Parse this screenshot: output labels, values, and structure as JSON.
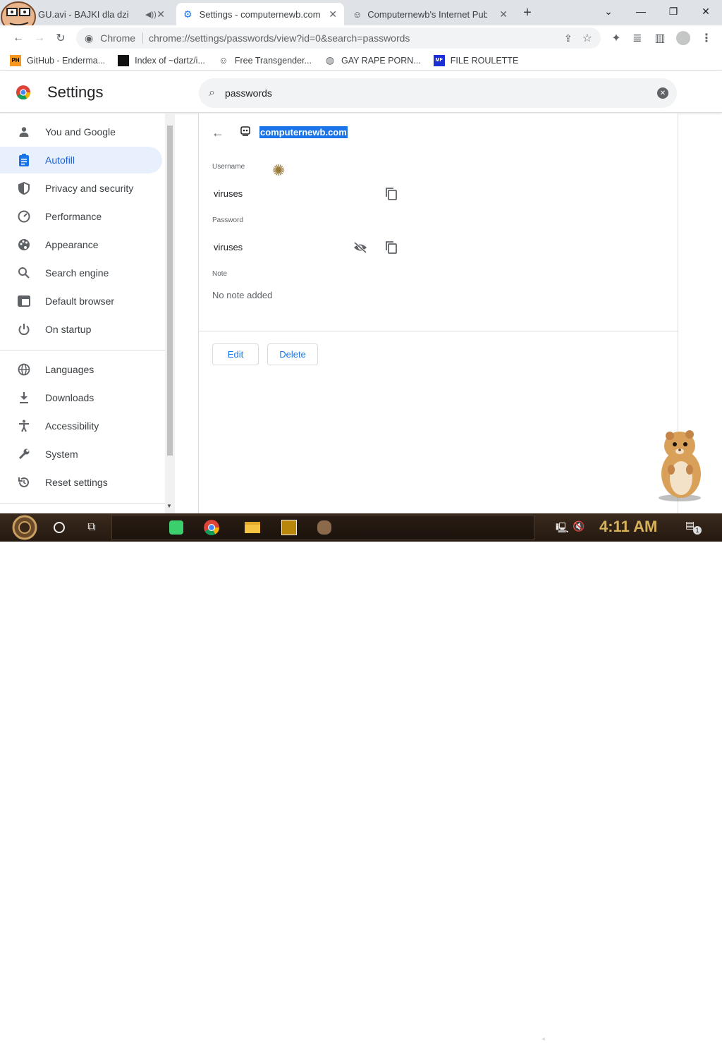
{
  "colors": {
    "accent": "#1a73e8",
    "active_nav_bg": "#e8f0fe",
    "highlight": "#1a73e8",
    "clock": "#d8b25a"
  },
  "tabs": [
    {
      "title": "GU.avi - BAJKI dla dzi",
      "audio_icon": "speaker-icon",
      "active": false
    },
    {
      "title": "Settings - computernewb.com",
      "active": true
    },
    {
      "title": "Computernewb's Internet Pub",
      "active": false
    }
  ],
  "omnibox": {
    "chip": "Chrome",
    "url": "chrome://settings/passwords/view?id=0&search=passwords"
  },
  "bookmarks": [
    {
      "label": "GitHub - Enderma...",
      "icon": "PH"
    },
    {
      "label": "Index of ~dartz/i...",
      "icon": "grid"
    },
    {
      "label": "Free Transgender...",
      "icon": "face"
    },
    {
      "label": "GAY RAPE PORN...",
      "icon": "globe"
    },
    {
      "label": "FILE ROULETTE",
      "icon": "MF"
    }
  ],
  "settings": {
    "title": "Settings",
    "search_value": "passwords"
  },
  "sidebar": {
    "items": [
      {
        "label": "You and Google",
        "icon": "person-icon"
      },
      {
        "label": "Autofill",
        "icon": "clipboard-icon",
        "active": true
      },
      {
        "label": "Privacy and security",
        "icon": "shield-icon"
      },
      {
        "label": "Performance",
        "icon": "speedometer-icon"
      },
      {
        "label": "Appearance",
        "icon": "palette-icon"
      },
      {
        "label": "Search engine",
        "icon": "search-icon"
      },
      {
        "label": "Default browser",
        "icon": "browser-icon"
      },
      {
        "label": "On startup",
        "icon": "power-icon"
      },
      {
        "label": "Languages",
        "icon": "globe-icon"
      },
      {
        "label": "Downloads",
        "icon": "download-icon"
      },
      {
        "label": "Accessibility",
        "icon": "accessibility-icon"
      },
      {
        "label": "System",
        "icon": "wrench-icon"
      },
      {
        "label": "Reset settings",
        "icon": "reset-icon"
      }
    ]
  },
  "password_detail": {
    "site": "computernewb.com",
    "username_label": "Username",
    "username": "viruses",
    "password_label": "Password",
    "password": "viruses",
    "note_label": "Note",
    "note": "No note added",
    "edit_label": "Edit",
    "delete_label": "Delete"
  },
  "taskbar": {
    "clock": "4:11 AM",
    "notification_count": "1"
  }
}
